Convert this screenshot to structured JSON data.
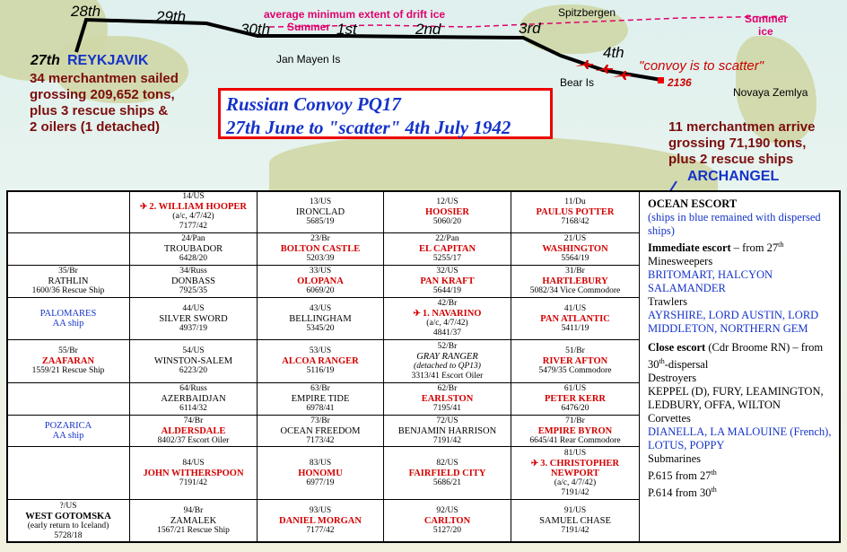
{
  "map": {
    "dates": [
      "28th",
      "29th",
      "30th",
      "1st",
      "2nd",
      "3rd",
      "4th"
    ],
    "reykjavik_date": "27th",
    "reykjavik": "REYKJAVIK",
    "departure_lines": [
      "34 merchantmen sailed",
      "grossing 209,652 tons,",
      "plus 3 rescue ships &",
      "2 oilers (1 detached)"
    ],
    "drift_ice": "average minimum extent of drift ice",
    "summer_1": "Summer",
    "summer_2": "Summer",
    "ice": "ice",
    "spitzbergen": "Spitzbergen",
    "jan_mayen": "Jan Mayen Is",
    "bear_is": "Bear Is",
    "scatter": "\"convoy is to scatter\"",
    "scatter_time": "2136",
    "novaya_zemlya": "Novaya Zemlya",
    "title_line1": "Russian Convoy PQ17",
    "title_line2": "27th June to \"scatter\" 4th July 1942",
    "arrival_lines": [
      "11 merchantmen arrive",
      "grossing 71,190 tons,",
      "plus 2 rescue ships"
    ],
    "archangel": "ARCHANGEL"
  },
  "grid": [
    [
      {},
      {
        "id": "14/US",
        "name": "2. WILLIAM HOOPER",
        "status": "lost",
        "plane": true,
        "note": "(a/c, 4/7/42)",
        "ton": "7177/42"
      },
      {
        "id": "13/US",
        "name": "IRONCLAD",
        "ton": "5685/19"
      },
      {
        "id": "12/US",
        "name": "HOOSIER",
        "status": "lost",
        "ton": "5060/20"
      },
      {
        "id": "11/Du",
        "name": "PAULUS POTTER",
        "status": "lost",
        "ton": "7168/42"
      }
    ],
    [
      {},
      {
        "id": "24/Pan",
        "name": "TROUBADOR",
        "ton": "6428/20"
      },
      {
        "id": "23/Br",
        "name": "BOLTON CASTLE",
        "status": "lost",
        "ton": "5203/39"
      },
      {
        "id": "22/Pan",
        "name": "EL CAPITAN",
        "status": "lost",
        "ton": "5255/17"
      },
      {
        "id": "21/US",
        "name": "WASHINGTON",
        "status": "lost",
        "ton": "5564/19"
      }
    ],
    [
      {
        "id": "35/Br",
        "name": "RATHLIN",
        "ton": "1600/36 Rescue Ship"
      },
      {
        "id": "34/Russ",
        "name": "DONBASS",
        "ton": "7925/35"
      },
      {
        "id": "33/US",
        "name": "OLOPANA",
        "status": "lost",
        "ton": "6069/20"
      },
      {
        "id": "32/US",
        "name": "PAN KRAFT",
        "status": "lost",
        "ton": "5644/19"
      },
      {
        "id": "31/Br",
        "name": "HARTLEBURY",
        "status": "lost",
        "ton": "5082/34 Vice Commodore"
      }
    ],
    [
      {
        "name": "PALOMARES",
        "name2": "AA ship",
        "status": "blue"
      },
      {
        "id": "44/US",
        "name": "SILVER SWORD",
        "ton": "4937/19"
      },
      {
        "id": "43/US",
        "name": "BELLINGHAM",
        "ton": "5345/20"
      },
      {
        "id": "42/Br",
        "name": "1. NAVARINO",
        "status": "lost",
        "plane": true,
        "note": "(a/c, 4/7/42)",
        "ton": "4841/37"
      },
      {
        "id": "41/US",
        "name": "PAN ATLANTIC",
        "status": "lost",
        "ton": "5411/19"
      }
    ],
    [
      {
        "id": "55/Br",
        "name": "ZAAFARAN",
        "status": "lost",
        "ton": "1559/21 Rescue Ship"
      },
      {
        "id": "54/US",
        "name": "WINSTON-SALEM",
        "ton": "6223/20"
      },
      {
        "id": "53/US",
        "name": "ALCOA RANGER",
        "status": "lost",
        "ton": "5116/19"
      },
      {
        "id": "52/Br",
        "name": "GRAY RANGER",
        "note": "(detached to QP13)",
        "ton": "3313/41 Escort Oiler"
      },
      {
        "id": "51/Br",
        "name": "RIVER AFTON",
        "status": "lost",
        "ton": "5479/35 Commodore"
      }
    ],
    [
      {},
      {
        "id": "64/Russ",
        "name": "AZERBAIDJAN",
        "ton": "6114/32"
      },
      {
        "id": "63/Br",
        "name": "EMPIRE TIDE",
        "ton": "6978/41"
      },
      {
        "id": "62/Br",
        "name": "EARLSTON",
        "status": "lost",
        "ton": "7195/41"
      },
      {
        "id": "61/US",
        "name": "PETER KERR",
        "status": "lost",
        "ton": "6476/20"
      }
    ],
    [
      {
        "name": "POZARICA",
        "name2": "AA ship",
        "status": "blue"
      },
      {
        "id": "74/Br",
        "name": "ALDERSDALE",
        "status": "lost",
        "ton": "8402/37 Escort Oiler"
      },
      {
        "id": "73/Br",
        "name": "OCEAN FREEDOM",
        "ton": "7173/42"
      },
      {
        "id": "72/US",
        "name": "BENJAMIN HARRISON",
        "ton": "7191/42"
      },
      {
        "id": "71/Br",
        "name": "EMPIRE BYRON",
        "status": "lost",
        "ton": "6645/41 Rear Commodore"
      }
    ],
    [
      {},
      {
        "id": "84/US",
        "name": "JOHN WITHERSPOON",
        "status": "lost",
        "ton": "7191/42"
      },
      {
        "id": "83/US",
        "name": "HONOMU",
        "status": "lost",
        "ton": "6977/19"
      },
      {
        "id": "82/US",
        "name": "FAIRFIELD CITY",
        "status": "lost",
        "ton": "5686/21"
      },
      {
        "id": "81/US",
        "name": "3. CHRISTOPHER NEWPORT",
        "status": "lost",
        "plane": true,
        "note": "(a/c, 4/7/42)",
        "ton": "7191/42"
      }
    ],
    [
      {
        "id": "?/US",
        "name": "WEST GOTOMSKA",
        "status": "bold",
        "note": "(early return to Iceland)",
        "ton": "5728/18"
      },
      {
        "id": "94/Br",
        "name": "ZAMALEK",
        "ton": "1567/21 Rescue Ship"
      },
      {
        "id": "93/US",
        "name": "DANIEL MORGAN",
        "status": "lost",
        "ton": "7177/42"
      },
      {
        "id": "92/US",
        "name": "CARLTON",
        "status": "lost",
        "ton": "5127/20"
      },
      {
        "id": "91/US",
        "name": "SAMUEL CHASE",
        "ton": "7191/42"
      }
    ]
  ],
  "escort": {
    "title": "OCEAN ESCORT",
    "blue_note": "(ships in blue remained with dispersed ships)",
    "immediate_head": "Immediate escort",
    "immediate_text": " – from 27",
    "immediate_sup": "th",
    "minesweepers": "Minesweepers",
    "minesweepers_names": "BRITOMART, HALCYON SALAMANDER",
    "trawlers": "Trawlers",
    "trawlers_names": "AYRSHIRE, LORD AUSTIN, LORD MIDDLETON, NORTHERN GEM",
    "close_head": "Close escort",
    "close_text": " (Cdr Broome RN) – from 30",
    "close_sup": "th",
    "close_tail": "-dispersal",
    "destroyers": "Destroyers",
    "destroyers_names": "KEPPEL (D),  FURY, LEAMINGTON, LEDBURY, OFFA, WILTON",
    "corvettes": "Corvettes",
    "corvettes_names": "DIANELLA, LA MALOUINE (French), LOTUS, POPPY",
    "submarines": "Submarines",
    "sub1": "P.615 from 27",
    "sub1_sup": "th",
    "sub2": "P.614 from 30",
    "sub2_sup": "th"
  }
}
